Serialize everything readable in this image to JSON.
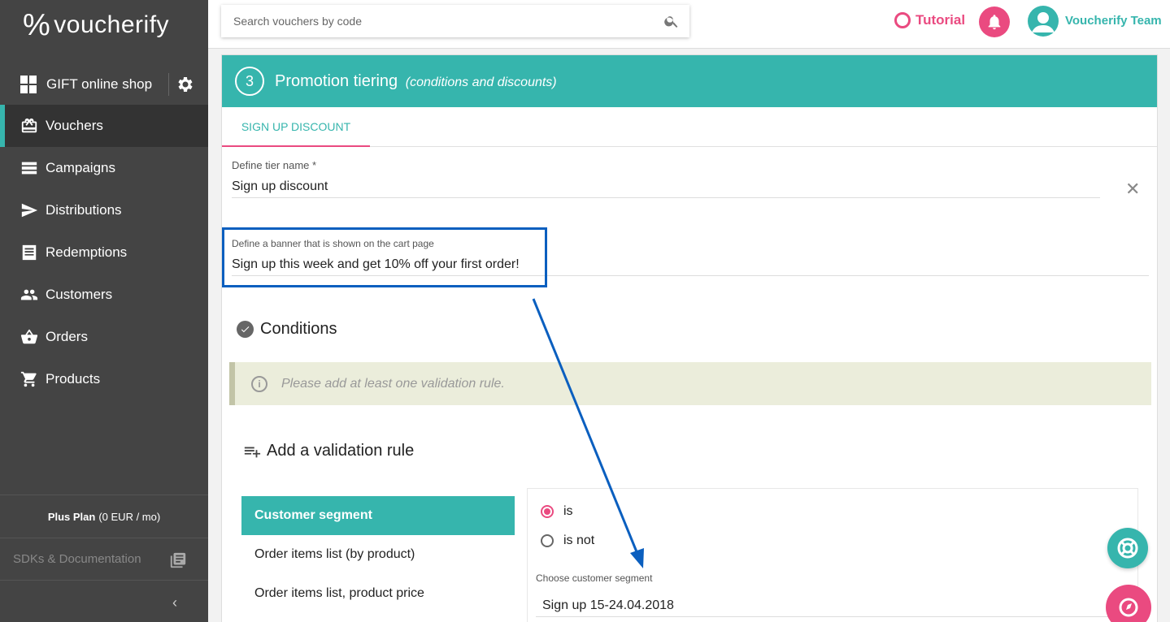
{
  "app": {
    "name": "voucherify",
    "logo_symbol": "%"
  },
  "sidebar": {
    "shop": {
      "label": "GIFT online shop"
    },
    "items": [
      {
        "label": "Vouchers",
        "icon": "voucher-icon",
        "active": true
      },
      {
        "label": "Campaigns",
        "icon": "campaigns-icon",
        "active": false
      },
      {
        "label": "Distributions",
        "icon": "send-icon",
        "active": false
      },
      {
        "label": "Redemptions",
        "icon": "receipt-icon",
        "active": false
      },
      {
        "label": "Customers",
        "icon": "people-icon",
        "active": false
      },
      {
        "label": "Orders",
        "icon": "basket-icon",
        "active": false
      },
      {
        "label": "Products",
        "icon": "cart-icon",
        "active": false
      }
    ],
    "plan": {
      "name": "Plus Plan",
      "price": "(0 EUR / mo)"
    },
    "sdk": {
      "label": "SDKs & Documentation"
    },
    "collapse_glyph": "‹"
  },
  "topbar": {
    "search_placeholder": "Search vouchers by code",
    "tutorial_label": "Tutorial",
    "user_name": "Voucherify Team"
  },
  "step": {
    "number": "3",
    "title": "Promotion tiering",
    "subtitle": "(conditions and discounts)"
  },
  "tab": {
    "label": "SIGN UP DISCOUNT"
  },
  "form": {
    "tier_name_label": "Define tier name *",
    "tier_name_value": "Sign up discount",
    "banner_label": "Define a banner that is shown on the cart page",
    "banner_value": "Sign up this week and get 10% off your first order!"
  },
  "conditions": {
    "heading": "Conditions",
    "warning": "Please add at least one validation rule.",
    "add_rule": "Add a validation rule",
    "rule_types": [
      {
        "label": "Customer segment",
        "active": true
      },
      {
        "label": "Order items list (by product)",
        "active": false
      },
      {
        "label": "Order items list, product price",
        "active": false
      }
    ],
    "operators": [
      {
        "label": "is",
        "selected": true
      },
      {
        "label": "is not",
        "selected": false
      }
    ],
    "segment_label": "Choose customer segment",
    "segment_value": "Sign up 15-24.04.2018"
  },
  "colors": {
    "teal": "#36b5ad",
    "pink": "#ea4a80",
    "sidebar": "#444444",
    "annotation_blue": "#0b5fbf"
  }
}
